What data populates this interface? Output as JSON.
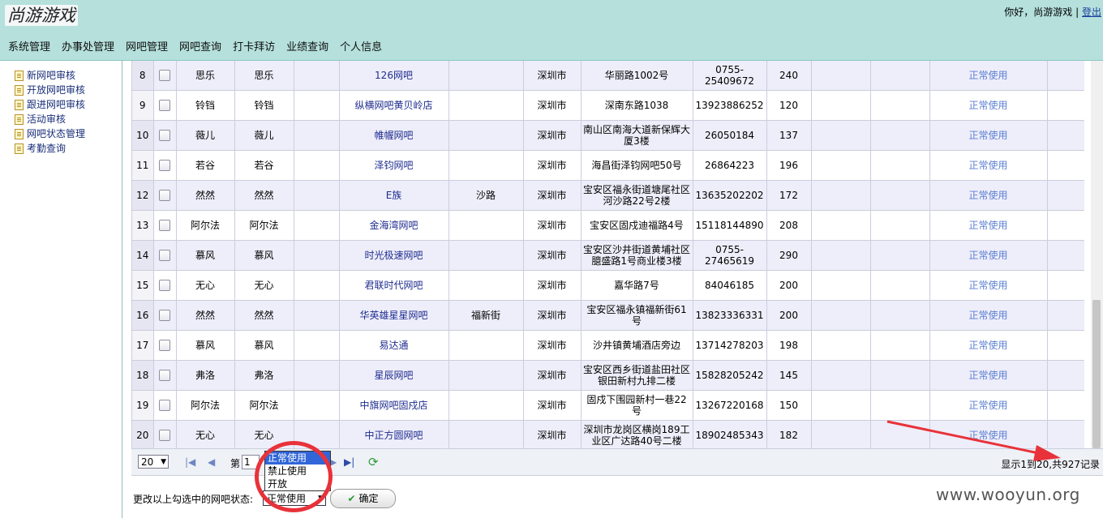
{
  "header": {
    "logo": "尚游游戏",
    "greeting": "你好，尚游游戏",
    "logout": "登出"
  },
  "nav": [
    "系统管理",
    "办事处管理",
    "网吧管理",
    "网吧查询",
    "打卡拜访",
    "业绩查询",
    "个人信息"
  ],
  "sidebar": {
    "items": [
      "新网吧审核",
      "开放网吧审核",
      "跟进网吧审核",
      "活动审核",
      "网吧状态管理",
      "考勤查询"
    ]
  },
  "table": {
    "rows": [
      {
        "no": "8",
        "c1": "思乐",
        "c2": "思乐",
        "c3": "",
        "name": "126网吧",
        "district": "",
        "city": "深圳市",
        "address": "华丽路1002号",
        "phone": "0755-25409672",
        "count": "240",
        "e1": "",
        "e2": "",
        "status": "正常使用",
        "e3": ""
      },
      {
        "no": "9",
        "c1": "铃铛",
        "c2": "铃铛",
        "c3": "",
        "name": "纵横网吧黄贝岭店",
        "district": "",
        "city": "深圳市",
        "address": "深南东路1038",
        "phone": "13923886252",
        "count": "120",
        "e1": "",
        "e2": "",
        "status": "正常使用",
        "e3": ""
      },
      {
        "no": "10",
        "c1": "薇儿",
        "c2": "薇儿",
        "c3": "",
        "name": "帷幄网吧",
        "district": "",
        "city": "深圳市",
        "address": "南山区南海大道新保辉大厦3楼",
        "phone": "26050184",
        "count": "137",
        "e1": "",
        "e2": "",
        "status": "正常使用",
        "e3": ""
      },
      {
        "no": "11",
        "c1": "若谷",
        "c2": "若谷",
        "c3": "",
        "name": "泽钧网吧",
        "district": "",
        "city": "深圳市",
        "address": "海昌街泽钧网吧50号",
        "phone": "26864223",
        "count": "196",
        "e1": "",
        "e2": "",
        "status": "正常使用",
        "e3": ""
      },
      {
        "no": "12",
        "c1": "然然",
        "c2": "然然",
        "c3": "",
        "name": "E族",
        "district": "沙路",
        "city": "深圳市",
        "address": "宝安区福永街道塘尾社区河沙路22号2楼",
        "phone": "13635202202",
        "count": "172",
        "e1": "",
        "e2": "",
        "status": "正常使用",
        "e3": ""
      },
      {
        "no": "13",
        "c1": "阿尔法",
        "c2": "阿尔法",
        "c3": "",
        "name": "金海湾网吧",
        "district": "",
        "city": "深圳市",
        "address": "宝安区固戍迪福路4号",
        "phone": "15118144890",
        "count": "208",
        "e1": "",
        "e2": "",
        "status": "正常使用",
        "e3": ""
      },
      {
        "no": "14",
        "c1": "慕风",
        "c2": "慕风",
        "c3": "",
        "name": "时光极速网吧",
        "district": "",
        "city": "深圳市",
        "address": "宝安区沙井街道黄埔社区臆盛路1号商业楼3楼",
        "phone": "0755-27465619",
        "count": "290",
        "e1": "",
        "e2": "",
        "status": "正常使用",
        "e3": ""
      },
      {
        "no": "15",
        "c1": "无心",
        "c2": "无心",
        "c3": "",
        "name": "君联时代网吧",
        "district": "",
        "city": "深圳市",
        "address": "嘉华路7号",
        "phone": "84046185",
        "count": "200",
        "e1": "",
        "e2": "",
        "status": "正常使用",
        "e3": ""
      },
      {
        "no": "16",
        "c1": "然然",
        "c2": "然然",
        "c3": "",
        "name": "华英雄星星网吧",
        "district": "福新街",
        "city": "深圳市",
        "address": "宝安区福永镇福新街61号",
        "phone": "13823336331",
        "count": "200",
        "e1": "",
        "e2": "",
        "status": "正常使用",
        "e3": ""
      },
      {
        "no": "17",
        "c1": "慕风",
        "c2": "慕风",
        "c3": "",
        "name": "易达通",
        "district": "",
        "city": "深圳市",
        "address": "沙井镇黄埔酒店旁边",
        "phone": "13714278203",
        "count": "198",
        "e1": "",
        "e2": "",
        "status": "正常使用",
        "e3": ""
      },
      {
        "no": "18",
        "c1": "弗洛",
        "c2": "弗洛",
        "c3": "",
        "name": "星辰网吧",
        "district": "",
        "city": "深圳市",
        "address": "宝安区西乡街道盐田社区银田新村九排二楼",
        "phone": "15828205242",
        "count": "145",
        "e1": "",
        "e2": "",
        "status": "正常使用",
        "e3": ""
      },
      {
        "no": "19",
        "c1": "阿尔法",
        "c2": "阿尔法",
        "c3": "",
        "name": "中旗网吧固戍店",
        "district": "",
        "city": "深圳市",
        "address": "固戍下围园新村一巷22号",
        "phone": "13267220168",
        "count": "150",
        "e1": "",
        "e2": "",
        "status": "正常使用",
        "e3": ""
      },
      {
        "no": "20",
        "c1": "无心",
        "c2": "无心",
        "c3": "",
        "name": "中正方圆网吧",
        "district": "",
        "city": "深圳市",
        "address": "深圳市龙岗区横岗189工业区广达路40号二楼",
        "phone": "18902485343",
        "count": "182",
        "e1": "",
        "e2": "",
        "status": "正常使用",
        "e3": ""
      }
    ]
  },
  "pager": {
    "page_size": "20",
    "page_prefix": "第",
    "page_value": "1",
    "info": "显示1到20,共927记录"
  },
  "dropdown": {
    "options": [
      "正常使用",
      "禁止使用",
      "开放"
    ],
    "selected_index": 0
  },
  "status_change": {
    "label": "更改以上勾选中的网吧状态:",
    "selected": "正常使用",
    "confirm": "确定"
  },
  "watermark": "www.wooyun.org",
  "colors": {
    "header_bg": "#b5e0dc",
    "alt_row": "#eeeefa",
    "link": "#1f2d8f",
    "status_link": "#5b7fd2",
    "annotation": "#e8323a"
  },
  "icons": {
    "sidebar_item": "document-icon",
    "pager": [
      "first-page-icon",
      "prev-page-icon",
      "next-page-icon",
      "last-page-icon",
      "refresh-icon"
    ]
  }
}
